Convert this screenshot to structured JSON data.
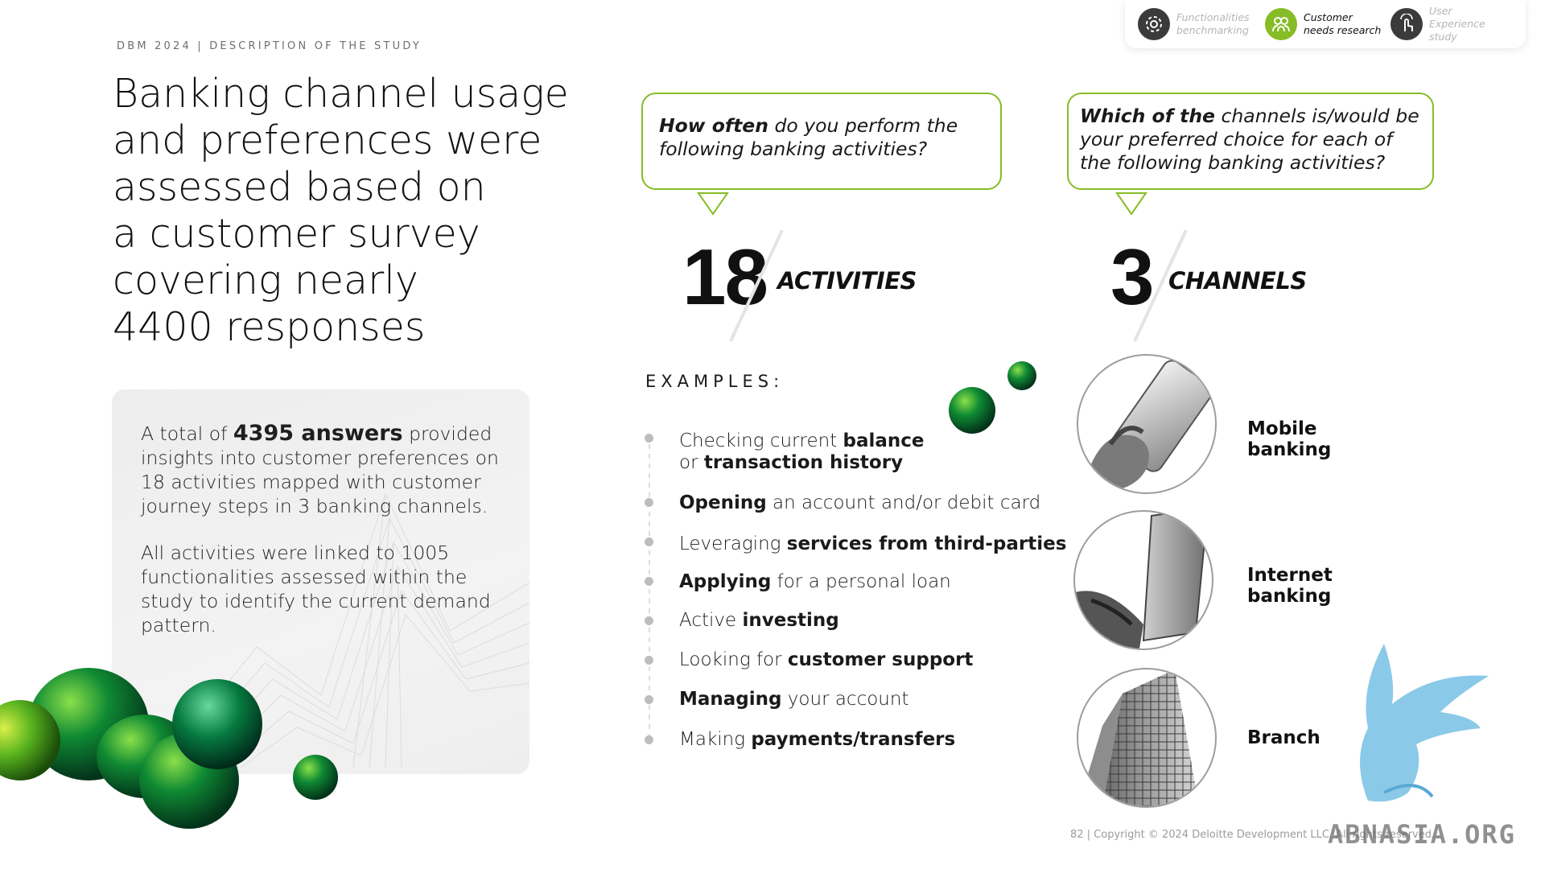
{
  "header": {
    "eyebrow": "DBM 2024 | DESCRIPTION OF THE STUDY",
    "title_lines": [
      "Banking channel usage",
      "and preferences were",
      "assessed based on",
      "a customer survey",
      "covering nearly",
      "4400 responses"
    ]
  },
  "steps": [
    {
      "label": "Functionalities benchmarking",
      "icon": "gear-icon",
      "active": false
    },
    {
      "label": "Customer needs research",
      "icon": "people-icon",
      "active": true
    },
    {
      "label": "User Experience study",
      "icon": "hand-touch-icon",
      "active": false
    }
  ],
  "info": {
    "p1_pre": "A total of",
    "p1_bold": "4395 answers",
    "p1_post": "provided insights into customer preferences on 18 activities mapped with customer journey steps in 3 banking channels.",
    "p2": "All activities were linked to 1005 functionalities assessed within the study to identify the current demand pattern."
  },
  "question1": {
    "bold": "How often",
    "rest": "do you perform the following banking activities?"
  },
  "question2": {
    "bold": "Which of the",
    "rest": "channels is/would be your preferred choice for each of the following banking activities?"
  },
  "stat1": {
    "number": "18",
    "word": "ACTIVITIES"
  },
  "stat2": {
    "number": "3",
    "word": "CHANNELS"
  },
  "examples_heading": "EXAMPLES:",
  "examples": [
    {
      "a": "Checking current ",
      "b": "balance",
      "c": "",
      "a2": "or ",
      "b2": "transaction history"
    },
    {
      "a": "",
      "b": "Opening",
      "c": " an account and/or debit card"
    },
    {
      "a": "Leveraging ",
      "b": "services from third-parties",
      "c": ""
    },
    {
      "a": "",
      "b": "Applying",
      "c": " for a personal loan"
    },
    {
      "a": "Active ",
      "b": "investing",
      "c": ""
    },
    {
      "a": "Looking for ",
      "b": "customer support",
      "c": ""
    },
    {
      "a": "",
      "b": "Managing",
      "c": " your account"
    },
    {
      "a": "Making ",
      "b": "payments/transfers",
      "c": ""
    }
  ],
  "channels": [
    {
      "l1": "Mobile",
      "l2": "banking",
      "icon": "phone-in-hand-icon"
    },
    {
      "l1": "Internet",
      "l2": "banking",
      "icon": "laptop-icon"
    },
    {
      "l1": "Branch",
      "l2": "",
      "icon": "building-icon"
    }
  ],
  "footer": "82 | Copyright © 2024 Deloitte Development LLC. All rights reserved.",
  "watermark": "ABNASIA.ORG",
  "colors": {
    "accent": "#86bc25",
    "bird": "#7ec3e6",
    "green_dark": "#0a6b2b"
  }
}
